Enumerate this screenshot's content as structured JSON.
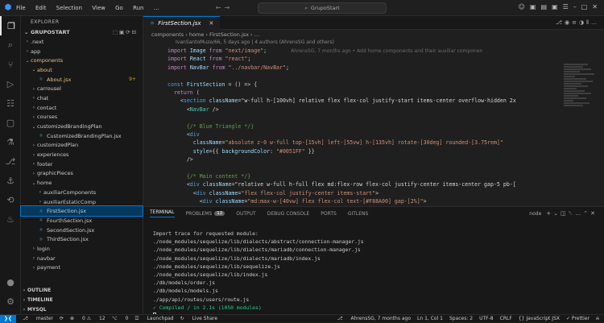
{
  "window": {
    "menu": [
      "File",
      "Edit",
      "Selection",
      "View",
      "Go",
      "Run",
      "…"
    ],
    "search": "GrupoStart"
  },
  "sidebar": {
    "title": "EXPLORER",
    "workspace": "GRUPOSTART",
    "tree": [
      {
        "label": ".next",
        "depth": 1,
        "type": "folder",
        "open": false
      },
      {
        "label": "app",
        "depth": 1,
        "type": "folder",
        "open": false
      },
      {
        "label": "components",
        "depth": 1,
        "type": "folder",
        "open": true,
        "modified": true
      },
      {
        "label": "about",
        "depth": 2,
        "type": "folder",
        "open": true,
        "modified": true
      },
      {
        "label": "About.jsx",
        "depth": 3,
        "type": "file",
        "modified": true,
        "badge": "9+"
      },
      {
        "label": "carrousel",
        "depth": 2,
        "type": "folder",
        "open": false
      },
      {
        "label": "chat",
        "depth": 2,
        "type": "folder",
        "open": false
      },
      {
        "label": "contact",
        "depth": 2,
        "type": "folder",
        "open": false
      },
      {
        "label": "courses",
        "depth": 2,
        "type": "folder",
        "open": false
      },
      {
        "label": "customizedBrandingPlan",
        "depth": 2,
        "type": "folder",
        "open": true
      },
      {
        "label": "CustomizedBrandingPlan.jsx",
        "depth": 3,
        "type": "file"
      },
      {
        "label": "customizedPlan",
        "depth": 2,
        "type": "folder",
        "open": false
      },
      {
        "label": "experiences",
        "depth": 2,
        "type": "folder",
        "open": false
      },
      {
        "label": "footer",
        "depth": 2,
        "type": "folder",
        "open": false
      },
      {
        "label": "graphicPieces",
        "depth": 2,
        "type": "folder",
        "open": false
      },
      {
        "label": "home",
        "depth": 2,
        "type": "folder",
        "open": true
      },
      {
        "label": "auxiliarComponents",
        "depth": 3,
        "type": "folder",
        "open": false
      },
      {
        "label": "auxiliarEstaticComp",
        "depth": 3,
        "type": "folder",
        "open": false
      },
      {
        "label": "FirstSection.jsx",
        "depth": 3,
        "type": "file",
        "selected": true
      },
      {
        "label": "FourthSection.jsx",
        "depth": 3,
        "type": "file"
      },
      {
        "label": "SecondSection.jsx",
        "depth": 3,
        "type": "file"
      },
      {
        "label": "ThirdSection.jsx",
        "depth": 3,
        "type": "file"
      },
      {
        "label": "login",
        "depth": 2,
        "type": "folder",
        "open": false
      },
      {
        "label": "navbar",
        "depth": 2,
        "type": "folder",
        "open": false
      },
      {
        "label": "payment",
        "depth": 2,
        "type": "folder",
        "open": false
      }
    ],
    "sections": [
      "OUTLINE",
      "TIMELINE",
      "MYSQL"
    ]
  },
  "editor": {
    "tab": "FirstSection.jsx",
    "breadcrumb": "components › home › FirstSection.jsx › …",
    "blame_header": "IvanSantoMuze/66, 5 days ago | 4 authors (AhrensSG and others)",
    "ghost_blame": "AhrensSG, 7 months ago • Add home components and their auxiliar componen",
    "lines": [
      "import Image from \"next/image\";",
      "import React from \"react\";",
      "import NavBar from \"../navbar/NavBar\";",
      "",
      "const FirstSection = () => {",
      "  return (",
      "    <section className=\"w-full h-[100vh] relative flex flex-col justify-start items-center overflow-hidden 2x",
      "      <NavBar />",
      "",
      "      {/* Blue Triangle */}",
      "      <div",
      "        className=\"absolute z-0 w-full top-[15vh] left-[55vw] h-[135vh] rotate-[30deg] rounded-[3.75rem]\"",
      "        style={{ backgroundColor: \"#0051FF\" }}",
      "      />",
      "",
      "      {/* Main content */}",
      "      <div className=\"relative w-full h-full flex md:flex-row flex-col justify-center items-center gap-5 pb-[",
      "        <div className=\"flex flex-col justify-center items-start\">",
      "          <div className=\"md:max-w-[40vw] flex flex-col text-[#F88A00] gap-[2%]\">"
    ]
  },
  "panel": {
    "tabs": [
      "TERMINAL",
      "PROBLEMS",
      "OUTPUT",
      "DEBUG CONSOLE",
      "PORTS",
      "GITLENS"
    ],
    "problems_count": "12",
    "shell": "node",
    "terminal": [
      "Import trace for requested module:",
      "./node_modules/sequelize/lib/dialects/abstract/connection-manager.js",
      "./node_modules/sequelize/lib/dialects/mariadb/connection-manager.js",
      "./node_modules/sequelize/lib/dialects/mariadb/index.js",
      "./node_modules/sequelize/lib/sequelize.js",
      "./node_modules/sequelize/lib/index.js",
      "./db/models/order.js",
      "./db/models/models.js",
      "./app/api/routes/users/route.js"
    ],
    "compiled": "✓ Compiled / in 2.1s (1050 modules)"
  },
  "status": {
    "branch": "master",
    "sync": "⟳",
    "errors": "0",
    "warnings": "12",
    "ports": "0",
    "launchpad": "Launchpad",
    "live": "Live Share",
    "blame": "AhrensSG, 7 months ago",
    "position": "Ln 1, Col 1",
    "spaces": "Spaces: 2",
    "encoding": "UTF-8",
    "eol": "CRLF",
    "language": "{} JavaScript JSX",
    "prettier": "✓ Prettier"
  },
  "colors": {
    "accent": "#0078d4",
    "triangle": "#0051FF",
    "orange": "#F88A00"
  }
}
